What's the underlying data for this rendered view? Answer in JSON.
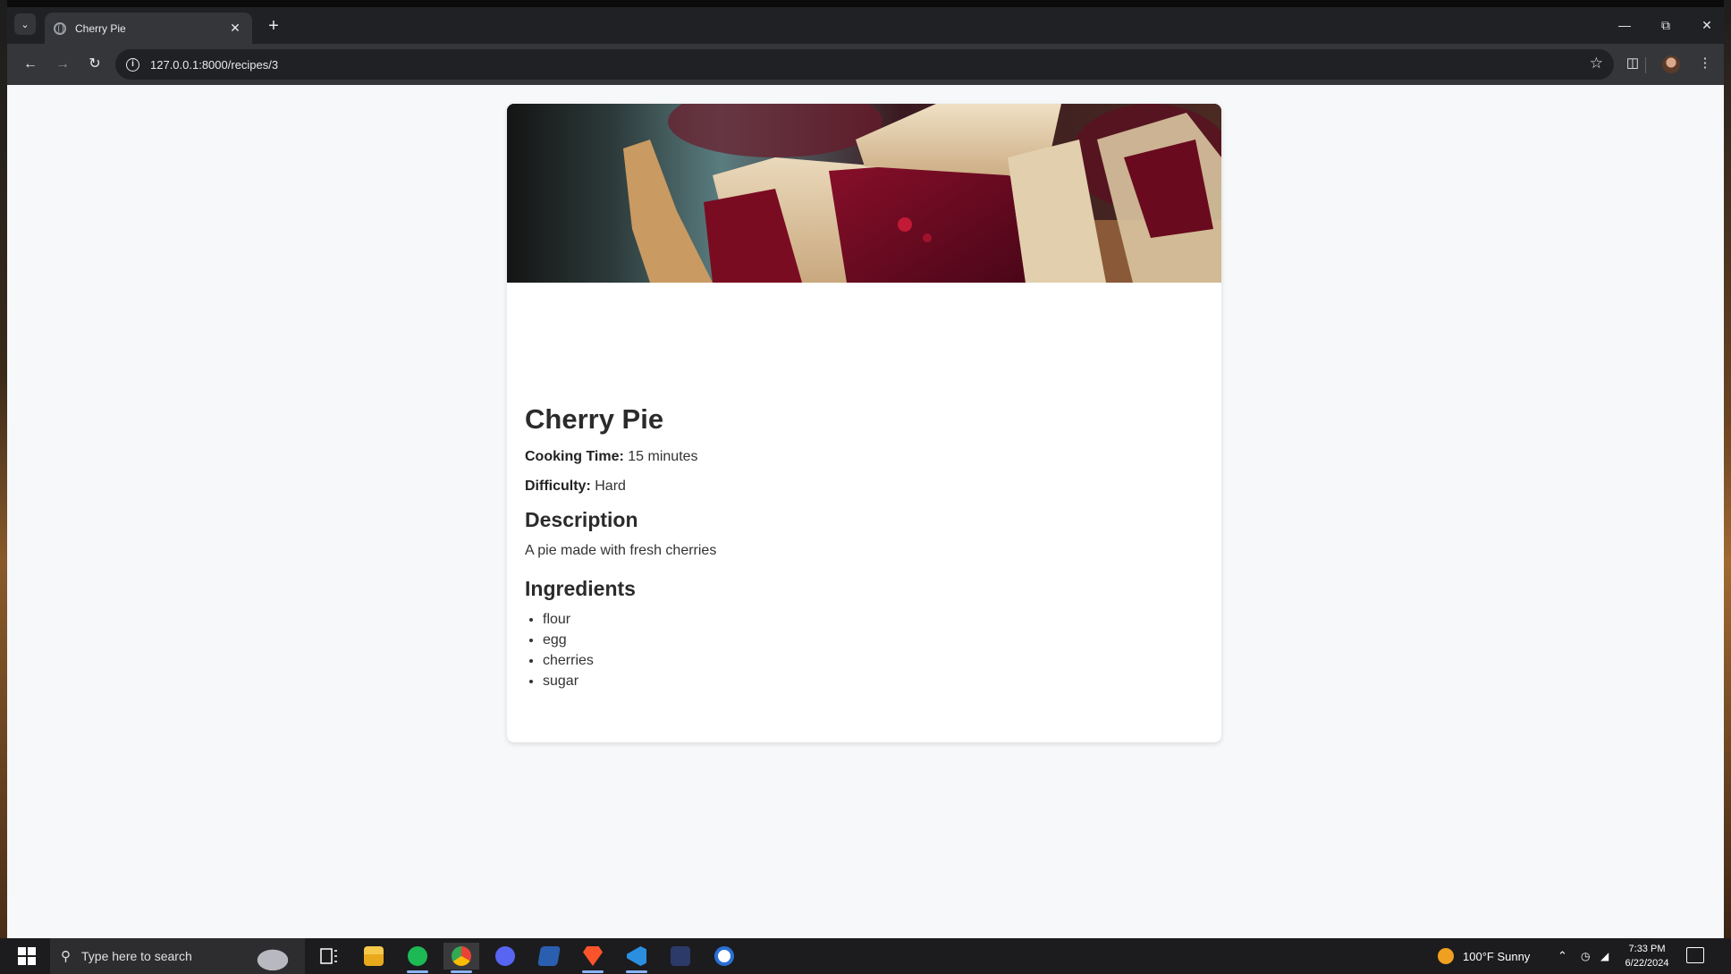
{
  "browser": {
    "tab_title": "Cherry Pie",
    "url": "127.0.0.1:8000/recipes/3"
  },
  "recipe": {
    "title": "Cherry Pie",
    "cooking_time_label": "Cooking Time:",
    "cooking_time_value": "15 minutes",
    "difficulty_label": "Difficulty:",
    "difficulty_value": "Hard",
    "description_heading": "Description",
    "description": "A pie made with fresh cherries",
    "ingredients_heading": "Ingredients",
    "ingredients": [
      "flour",
      "egg",
      "cherries",
      "sugar"
    ]
  },
  "taskbar": {
    "search_placeholder": "Type here to search",
    "weather": "100°F  Sunny",
    "time": "7:33 PM",
    "date": "6/22/2024"
  },
  "icons": {
    "spotify": "#1db954",
    "discord": "#5865f2",
    "vscode": "#2b8fe0",
    "brave": "#fb542b"
  }
}
